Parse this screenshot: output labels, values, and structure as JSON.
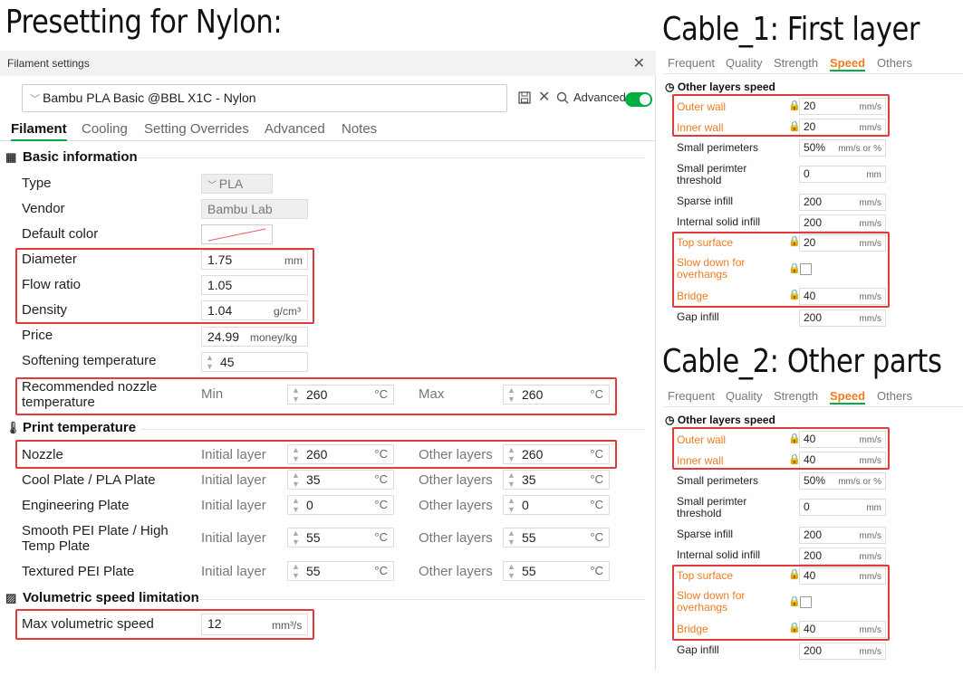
{
  "titles": {
    "left": "Presetting for Nylon:",
    "cable1": "Cable_1: First layer",
    "cable2": "Cable_2: Other parts"
  },
  "dialog": {
    "title": "Filament settings",
    "close": "✕",
    "preset": "Bambu PLA Basic @BBL X1C - Nylon",
    "advanced": "Advanced",
    "tabs": [
      "Filament",
      "Cooling",
      "Setting Overrides",
      "Advanced",
      "Notes"
    ]
  },
  "basic": {
    "title": "Basic information",
    "type_label": "Type",
    "type_value": "PLA",
    "vendor_label": "Vendor",
    "vendor_value": "Bambu Lab",
    "color_label": "Default color",
    "diameter_label": "Diameter",
    "diameter_value": "1.75",
    "diameter_unit": "mm",
    "flow_label": "Flow ratio",
    "flow_value": "1.05",
    "density_label": "Density",
    "density_value": "1.04",
    "density_unit": "g/cm³",
    "price_label": "Price",
    "price_value": "24.99",
    "price_unit": "money/kg",
    "soft_label": "Softening temperature",
    "soft_value": "45",
    "rec_label": "Recommended nozzle temperature",
    "min_label": "Min",
    "min_value": "260",
    "max_label": "Max",
    "max_value": "260",
    "deg": "°C"
  },
  "print_temp": {
    "title": "Print temperature",
    "initial": "Initial layer",
    "other": "Other layers",
    "rows": [
      {
        "label": "Nozzle",
        "init": "260",
        "other": "260"
      },
      {
        "label": "Cool Plate / PLA Plate",
        "init": "35",
        "other": "35"
      },
      {
        "label": "Engineering Plate",
        "init": "0",
        "other": "0"
      },
      {
        "label": "Smooth PEI Plate / High Temp Plate",
        "init": "55",
        "other": "55"
      },
      {
        "label": "Textured PEI Plate",
        "init": "55",
        "other": "55"
      }
    ]
  },
  "vol": {
    "title": "Volumetric speed limitation",
    "label": "Max volumetric speed",
    "value": "12",
    "unit": "mm³/s"
  },
  "panels": {
    "tabs": [
      "Frequent",
      "Quality",
      "Strength",
      "Speed",
      "Others"
    ],
    "head": "Other layers speed",
    "labels": {
      "outer": "Outer wall",
      "inner": "Inner wall",
      "small": "Small perimeters",
      "smallthr": "Small perimter threshold",
      "sparse": "Sparse infill",
      "internal": "Internal solid infill",
      "top": "Top surface",
      "slow": "Slow down for overhangs",
      "bridge": "Bridge",
      "gap": "Gap infill"
    },
    "units": {
      "mms": "mm/s",
      "mmsp": "mm/s or %",
      "mm": "mm"
    },
    "cable1": {
      "outer": "20",
      "inner": "20",
      "small": "50%",
      "smallthr": "0",
      "sparse": "200",
      "internal": "200",
      "top": "20",
      "bridge": "40",
      "gap": "200"
    },
    "cable2": {
      "outer": "40",
      "inner": "40",
      "small": "50%",
      "smallthr": "0",
      "sparse": "200",
      "internal": "200",
      "top": "40",
      "bridge": "40",
      "gap": "200"
    }
  }
}
